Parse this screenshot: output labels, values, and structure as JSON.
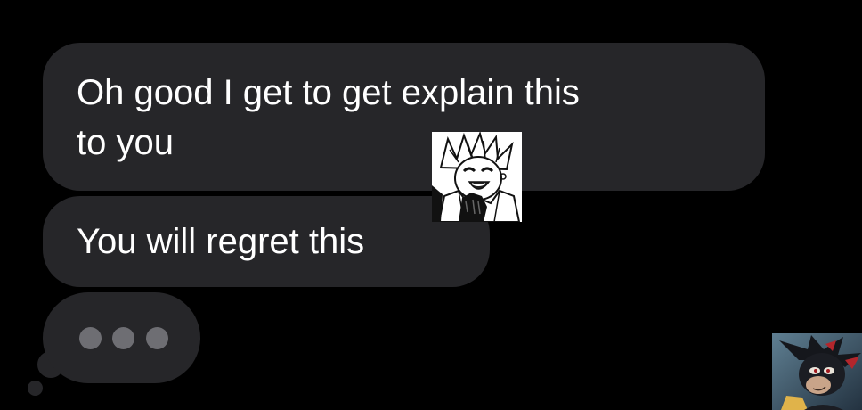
{
  "messages": [
    {
      "text_line1": "Oh good I get to get explain this",
      "text_line2": "to you"
    },
    {
      "text": "You will regret this"
    }
  ],
  "typing_indicator": {
    "dots": 3
  },
  "sticker": {
    "icon": "manga-character-sticker"
  },
  "avatar": {
    "icon": "contact-avatar"
  },
  "colors": {
    "background": "#000000",
    "bubble": "#262629",
    "text": "#ffffff",
    "dot": "#6e6e73"
  }
}
